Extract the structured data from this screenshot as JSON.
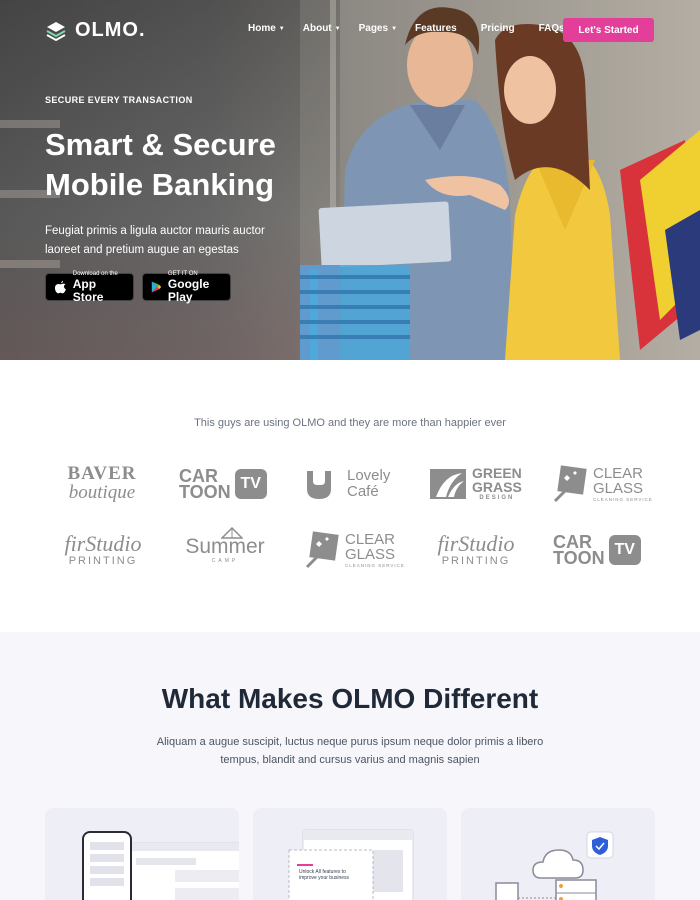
{
  "brand": {
    "name": "OLMO."
  },
  "nav": {
    "items": [
      {
        "label": "Home",
        "caret": true
      },
      {
        "label": "About",
        "caret": true
      },
      {
        "label": "Pages",
        "caret": true
      },
      {
        "label": "Features",
        "caret": false
      },
      {
        "label": "Pricing",
        "caret": false
      },
      {
        "label": "FAQs",
        "caret": false
      }
    ],
    "cta_label": "Let's Started"
  },
  "hero": {
    "eyebrow": "SECURE EVERY TRANSACTION",
    "title": "Smart & Secure Mobile Banking",
    "subtitle": "Feugiat primis a ligula auctor mauris auctor laoreet and pretium augue an egestas",
    "app_store": {
      "small": "Download on the",
      "big": "App Store"
    },
    "google_play": {
      "small": "GET IT ON",
      "big": "Google Play"
    }
  },
  "clients": {
    "intro": "This guys are using OLMO and they are more than happier ever",
    "logos": [
      {
        "line1": "BAVER",
        "line2": "boutique"
      },
      {
        "line1": "CAR",
        "line2": "TOON",
        "badge": "TV"
      },
      {
        "line1": "Lovely",
        "line2": "Café"
      },
      {
        "line1": "GREEN",
        "line2": "GRASS",
        "line3": "DESIGN"
      },
      {
        "line1": "CLEAR",
        "line2": "GLASS",
        "line3": "CLEANING SERVICE"
      },
      {
        "line1": "firStudio",
        "line2": "PRINTING"
      },
      {
        "line1": "Summer",
        "line2": "CAMP"
      },
      {
        "line1": "CLEAR",
        "line2": "GLASS",
        "line3": "CLEANING SERVICE"
      },
      {
        "line1": "firStudio",
        "line2": "PRINTING"
      },
      {
        "line1": "CAR",
        "line2": "TOON",
        "badge": "TV"
      }
    ]
  },
  "features": {
    "title": "What Makes OLMO Different",
    "subtitle": "Aliquam a augue suscipit, luctus neque purus ipsum neque dolor primis a libero tempus, blandit and cursus varius and magnis sapien",
    "card2_text": "Unlock All features to improve your business"
  },
  "colors": {
    "accent": "#e23e9a",
    "heading": "#1f2937",
    "logo_gray": "#8d8d8d",
    "section_bg": "#f6f6fb"
  }
}
